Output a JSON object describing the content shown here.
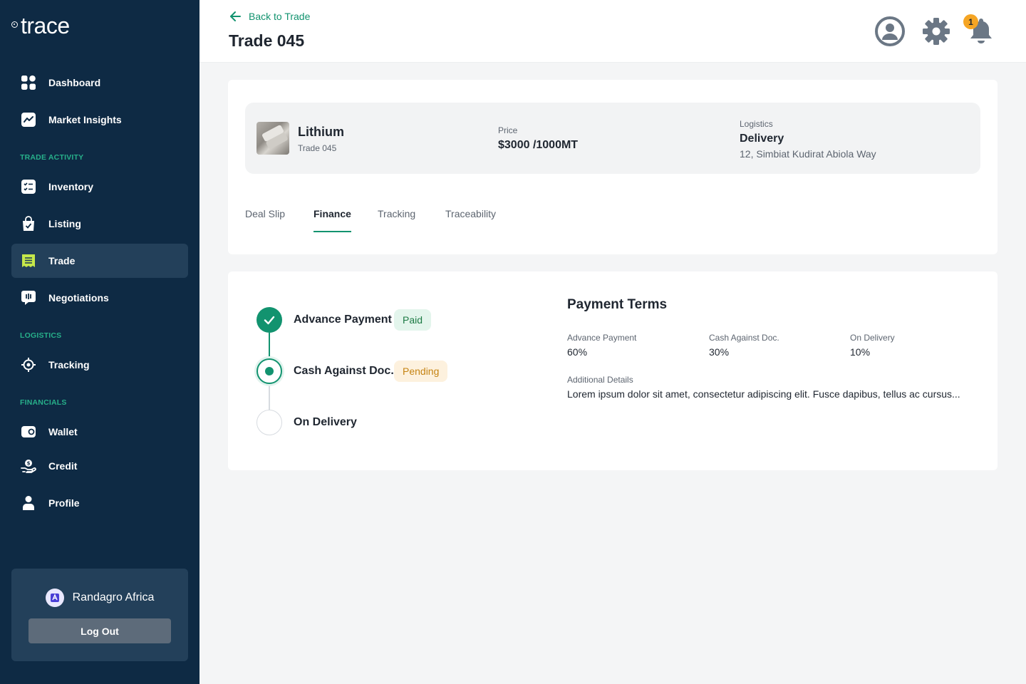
{
  "app": {
    "logo_text": "trace"
  },
  "sidebar": {
    "items": [
      {
        "label": "Dashboard",
        "icon": "dashboard-icon"
      },
      {
        "label": "Market Insights",
        "icon": "chart-icon"
      },
      {
        "label": "Inventory",
        "icon": "checklist-icon"
      },
      {
        "label": "Listing",
        "icon": "bag-check-icon"
      },
      {
        "label": "Trade",
        "icon": "receipt-icon",
        "active": true
      },
      {
        "label": "Negotiations",
        "icon": "chat-icon"
      },
      {
        "label": "Tracking",
        "icon": "target-icon"
      },
      {
        "label": "Wallet",
        "icon": "wallet-icon"
      },
      {
        "label": "Credit",
        "icon": "credit-hand-icon"
      },
      {
        "label": "Profile",
        "icon": "user-icon"
      }
    ],
    "sections": {
      "trade_activity": "TRADE ACTIVITY",
      "logistics": "LOGISTICS",
      "financials": "FINANCIALS"
    },
    "account": {
      "name": "Randagro Africa",
      "logout_label": "Log Out"
    }
  },
  "header": {
    "back_label": "Back to Trade",
    "title": "Trade 045",
    "notification_count": "1"
  },
  "summary": {
    "product_name": "Lithium",
    "product_sub": "Trade 045",
    "price_label": "Price",
    "price_value": "$3000 /1000MT",
    "logistics_label": "Logistics",
    "logistics_value": "Delivery",
    "logistics_address": "12, Simbiat Kudirat Abiola Way"
  },
  "tabs": [
    {
      "label": "Deal Slip"
    },
    {
      "label": "Finance",
      "active": true
    },
    {
      "label": "Tracking"
    },
    {
      "label": "Traceability"
    }
  ],
  "steps": [
    {
      "label": "Advance Payment",
      "status": "Paid",
      "state": "done"
    },
    {
      "label": "Cash Against Doc.",
      "status": "Pending",
      "state": "current"
    },
    {
      "label": "On Delivery",
      "status": "",
      "state": "todo"
    }
  ],
  "payment_terms": {
    "title": "Payment Terms",
    "terms": [
      {
        "label": "Advance Payment",
        "value": "60%"
      },
      {
        "label": "Cash Against Doc.",
        "value": "30%"
      },
      {
        "label": "On Delivery",
        "value": "10%"
      }
    ],
    "details_label": "Additional Details",
    "details_text": "Lorem ipsum dolor sit amet, consectetur adipiscing elit. Fusce dapibus, tellus ac cursus..."
  },
  "colors": {
    "sidebar_bg": "#0e2a44",
    "accent": "#12936f",
    "active_icon": "#c6e84a",
    "badge": "#f5a524"
  }
}
